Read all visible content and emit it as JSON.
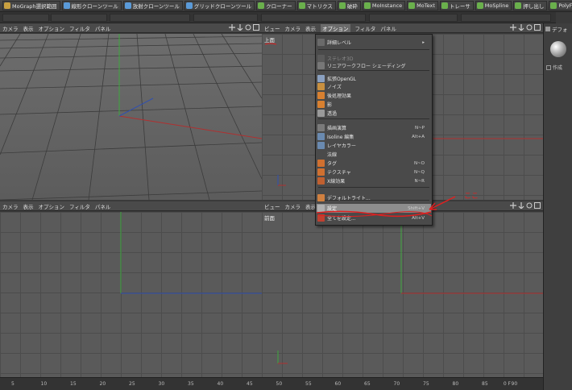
{
  "toolbar": {
    "buttons": [
      {
        "label": "MoGraph選択範囲",
        "icon": "mograph-selection-icon",
        "color": "#c8a040"
      },
      {
        "label": "線形クローンツール",
        "icon": "linear-clone-icon",
        "color": "#5a9ad8"
      },
      {
        "label": "放射クローンツール",
        "icon": "radial-clone-icon",
        "color": "#5a9ad8"
      },
      {
        "label": "グリッドクローンツール",
        "icon": "grid-clone-icon",
        "color": "#5a9ad8"
      },
      {
        "label": "クローナー",
        "icon": "cloner-icon",
        "color": "#6ab04c"
      },
      {
        "label": "マトリクス",
        "icon": "matrix-icon",
        "color": "#6ab04c"
      },
      {
        "label": "破砕",
        "icon": "fracture-icon",
        "color": "#6ab04c"
      },
      {
        "label": "MoInstance",
        "icon": "moinstance-icon",
        "color": "#6ab04c"
      },
      {
        "label": "MoText",
        "icon": "motext-icon",
        "color": "#6ab04c"
      },
      {
        "label": "トレーサ",
        "icon": "tracer-icon",
        "color": "#6ab04c"
      },
      {
        "label": "MoSpline",
        "icon": "mospline-icon",
        "color": "#6ab04c"
      },
      {
        "label": "押し出し",
        "icon": "extrude-icon",
        "color": "#6ab04c"
      },
      {
        "label": "PolyFX",
        "icon": "polyfx-icon",
        "color": "#6ab04c"
      }
    ]
  },
  "top_left_view": {
    "menus": [
      "カメラ",
      "表示",
      "オプション",
      "フィルタ",
      "パネル"
    ]
  },
  "top_right_view": {
    "menus": [
      "ビュー",
      "カメラ",
      "表示",
      "オプション",
      "フィルタ",
      "パネル"
    ],
    "active_menu_index": 3,
    "label": "上面"
  },
  "bottom_left_view": {
    "menus": [
      "カメラ",
      "表示",
      "オプション",
      "フィルタ",
      "パネル"
    ]
  },
  "bottom_right_view": {
    "menus": [
      "ビュー",
      "カメラ",
      "表示"
    ],
    "label": "前面"
  },
  "options_menu": {
    "items": [
      {
        "label": "詳細レベル",
        "shortcut": "",
        "submenu": true,
        "disabled": false,
        "icon": "detail-level-icon",
        "color": "#6a6a6a"
      },
      {
        "label": "ステレオ3D",
        "shortcut": "",
        "submenu": false,
        "disabled": true,
        "icon": "stereo-3d-icon",
        "color": "#5a5a5a"
      },
      {
        "label": "リニアワークフロー シェーディング",
        "shortcut": "",
        "submenu": false,
        "disabled": false,
        "icon": "linear-workflow-icon",
        "color": "#777777"
      },
      {
        "label": "拡張OpenGL",
        "shortcut": "",
        "submenu": false,
        "disabled": false,
        "icon": "opengl-icon",
        "color": "#8aa0c0"
      },
      {
        "label": "ノイズ",
        "shortcut": "",
        "submenu": false,
        "disabled": false,
        "icon": "noise-icon",
        "color": "#c89040"
      },
      {
        "label": "後処理効果",
        "shortcut": "",
        "submenu": false,
        "disabled": false,
        "icon": "post-effect-icon",
        "color": "#d88030"
      },
      {
        "label": "影",
        "shortcut": "",
        "submenu": false,
        "disabled": false,
        "icon": "shadow-icon",
        "color": "#d88030"
      },
      {
        "label": "透過",
        "shortcut": "",
        "submenu": false,
        "disabled": false,
        "icon": "transparency-icon",
        "color": "#9a9a9a"
      },
      {
        "label": "描画演算",
        "shortcut": "N~P",
        "submenu": false,
        "disabled": false,
        "icon": "draw-calc-icon",
        "color": "#7a7a7a"
      },
      {
        "label": "Isoline 編集",
        "shortcut": "Alt+A",
        "submenu": false,
        "disabled": false,
        "icon": "isoline-icon",
        "color": "#6a8ab0"
      },
      {
        "label": "レイヤカラー",
        "shortcut": "",
        "submenu": false,
        "disabled": false,
        "icon": "layer-color-icon",
        "color": "#6a8ab0"
      },
      {
        "label": "法線",
        "shortcut": "",
        "submenu": false,
        "disabled": false,
        "icon": "normal-icon",
        "color": "#4a4a4a"
      },
      {
        "label": "タグ",
        "shortcut": "N~O",
        "submenu": false,
        "disabled": false,
        "icon": "tag-icon",
        "color": "#d07030"
      },
      {
        "label": "テクスチャ",
        "shortcut": "N~Q",
        "submenu": false,
        "disabled": false,
        "icon": "texture-icon",
        "color": "#d07030"
      },
      {
        "label": "X線効果",
        "shortcut": "N~R",
        "submenu": false,
        "disabled": false,
        "icon": "xray-icon",
        "color": "#c06030"
      },
      {
        "label": "デフォルトライト...",
        "shortcut": "",
        "submenu": false,
        "disabled": false,
        "icon": "default-light-icon",
        "color": "#d08040"
      },
      {
        "label": "設定",
        "shortcut": "Shift+V",
        "submenu": false,
        "disabled": false,
        "icon": "settings-icon",
        "color": "#b0b0b0"
      },
      {
        "label": "全てを設定...",
        "shortcut": "Alt+V",
        "submenu": false,
        "disabled": false,
        "icon": "set-all-icon",
        "color": "#c04030"
      }
    ],
    "highlighted_index": 16
  },
  "annotation": {
    "text": "ここ",
    "color": "#e02020"
  },
  "right_panel": {
    "tab_label": "デフォ",
    "item_label": "作成"
  },
  "ruler": {
    "ticks": [
      "5",
      "10",
      "15",
      "20",
      "25",
      "30",
      "35",
      "40",
      "45",
      "50",
      "55",
      "60",
      "65",
      "70",
      "75",
      "80",
      "85",
      "90"
    ],
    "unit": "0 F"
  }
}
